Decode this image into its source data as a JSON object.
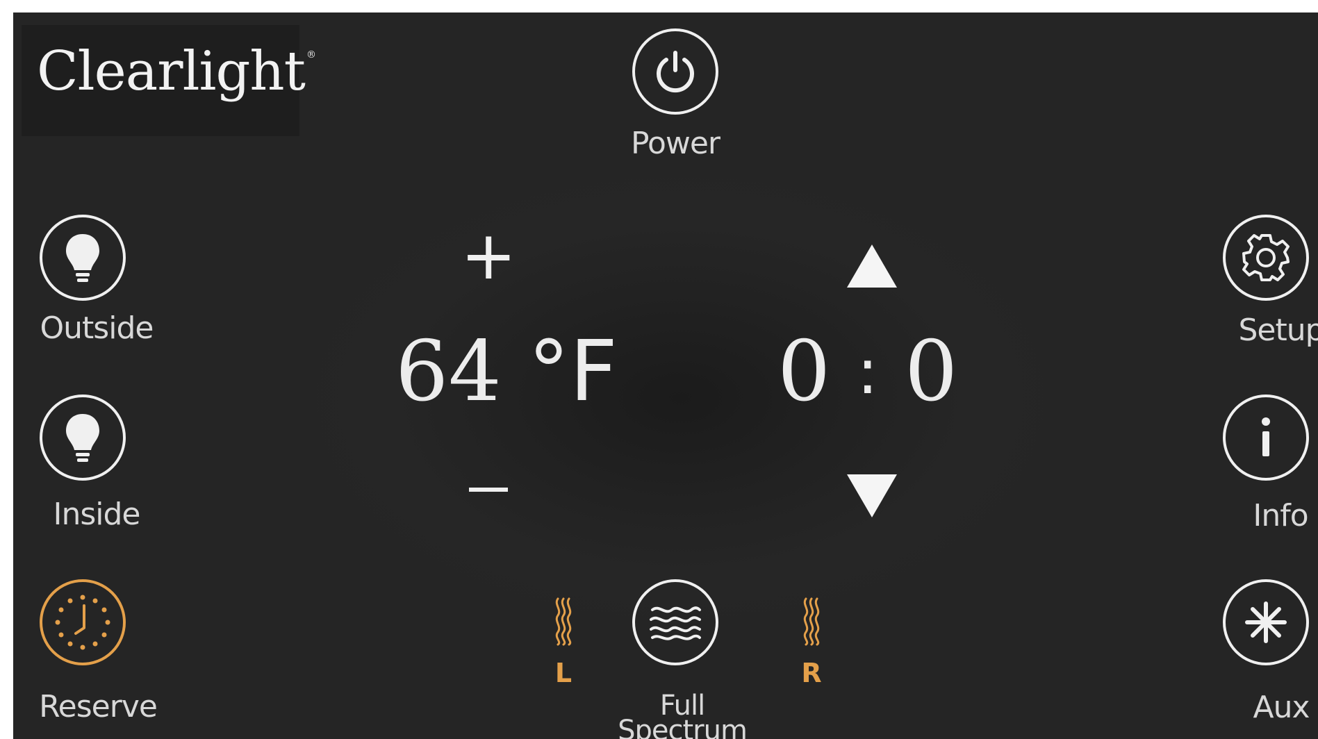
{
  "brand": {
    "name": "Clearlight",
    "mark": "®"
  },
  "power": {
    "label": "Power",
    "icon": "power-icon"
  },
  "left_buttons": [
    {
      "id": "outside",
      "label": "Outside",
      "icon": "lightbulb-icon"
    },
    {
      "id": "inside",
      "label": "Inside",
      "icon": "lightbulb-icon"
    },
    {
      "id": "reserve",
      "label": "Reserve",
      "icon": "clock-icon",
      "color": "#e4a04a"
    }
  ],
  "right_buttons": [
    {
      "id": "setup",
      "label": "Setup",
      "icon": "gear-icon"
    },
    {
      "id": "info",
      "label": "Info",
      "icon": "info-icon"
    },
    {
      "id": "aux",
      "label": "Aux",
      "icon": "asterisk-icon"
    }
  ],
  "temperature": {
    "value": "64",
    "unit": "°F",
    "increase": "+",
    "decrease": "–"
  },
  "timer": {
    "hours": "0",
    "separator": ":",
    "minutes": "0"
  },
  "heater": {
    "label_line1": "Full",
    "label_line2": "Spectrum",
    "icon": "heat-waves-icon",
    "left_zone": "L",
    "right_zone": "R",
    "zone_color": "#e4a04a"
  }
}
